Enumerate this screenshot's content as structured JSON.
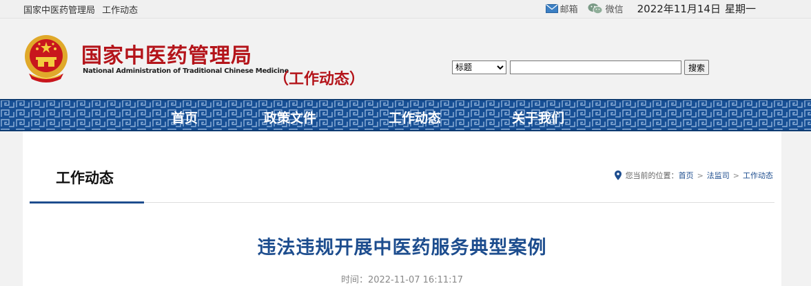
{
  "topbar": {
    "site": "国家中医药管理局",
    "section": "工作动态",
    "mail": "邮箱",
    "wechat": "微信",
    "date": "2022年11月14日",
    "weekday": "星期一"
  },
  "header": {
    "logo_cn": "国家中医药管理局",
    "logo_en": "National Administration of Traditional Chinese Medicine",
    "subtitle": "（工作动态）",
    "search": {
      "select_value": "标题",
      "input_value": "",
      "button": "搜索"
    }
  },
  "nav": {
    "items": [
      "首页",
      "政策文件",
      "工作动态",
      "关于我们"
    ]
  },
  "panel": {
    "title": "工作动态",
    "location_label": "您当前的位置：",
    "breadcrumb": [
      "首页",
      "法监司",
      "工作动态"
    ],
    "separator": ">"
  },
  "article": {
    "title": "违法违规开展中医药服务典型案例",
    "time_label": "时间：",
    "time": "2022-11-07 16:11:17"
  },
  "colors": {
    "brand_red": "#b4141a",
    "nav_blue": "#144a8c",
    "link_blue": "#1d4d8e"
  }
}
